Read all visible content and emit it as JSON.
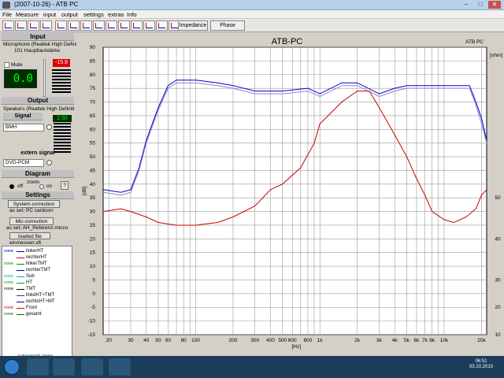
{
  "window": {
    "title": "(2007-10-26)  -  ATB PC",
    "minimize": "–",
    "maximize": "□",
    "close": "✕"
  },
  "menu": [
    "File",
    "Measure",
    "input",
    "output",
    "settings",
    "extras",
    "Info"
  ],
  "toolbar": {
    "impedance": "Impedance",
    "phase": "Phase"
  },
  "left": {
    "input_title": "Input",
    "input_device": "Microphone (Realtek High Defini",
    "input_channel": "101 Hauptlautstärke",
    "mute": "Mute",
    "in_lcd": "0.0",
    "in_level": "-15.8",
    "output_title": "Output",
    "output_device": "Speakers (Realtek High Definiti",
    "signal_title": "Signal",
    "signal_value": "BMH",
    "out_level": "2.50",
    "ext_title": "extern signal",
    "ext_value": "DVD-PCM",
    "diagram_title": "Diagram",
    "zoom": "zoom",
    "off": "off",
    "on": "on",
    "help": "?",
    "settings_title": "Settings",
    "sys_btn": "System-correction",
    "sys_as": "as set: PC cardcorr",
    "mic_btn": "Mic-correction",
    "mic_as": "as set: AH_Referenz.micco",
    "loaded_btn": "loaded file",
    "loaded_file": "einmessen.xft"
  },
  "legend": [
    {
      "a": "none",
      "b": "linkerHT",
      "color": "#0000cc",
      "acolor": "#0000cc"
    },
    {
      "a": "",
      "b": "rechterHT",
      "color": "#cc0000",
      "acolor": "#000"
    },
    {
      "a": "none",
      "b": "linkerTMT",
      "color": "#008800",
      "acolor": "#008800"
    },
    {
      "a": "",
      "b": "rechterTMT",
      "color": "#000088",
      "acolor": "#000"
    },
    {
      "a": "none",
      "b": "Sub",
      "color": "#00aaaa",
      "acolor": "#00aaaa"
    },
    {
      "a": "none",
      "b": "HT",
      "color": "#00aa00",
      "acolor": "#00aa00"
    },
    {
      "a": "none",
      "b": "TMT",
      "color": "#000000",
      "acolor": "#000"
    },
    {
      "a": "",
      "b": "linkdHT+TMT",
      "color": "#444444",
      "acolor": "#000"
    },
    {
      "a": "",
      "b": "rechtsHT+MT",
      "color": "#000088",
      "acolor": "#000"
    },
    {
      "a": "none",
      "b": "Front",
      "color": "#cc0000",
      "acolor": "#cc0000"
    },
    {
      "a": "none",
      "b": "gesamt",
      "color": "#006600",
      "acolor": "#006600"
    }
  ],
  "status": "autoexport: none",
  "clock": {
    "time": "06:51",
    "date": "03.10.2010"
  },
  "chart_data": {
    "type": "line",
    "title": "ATB-PC",
    "corner_label": "ATB PC",
    "xlabel": "[Hz]",
    "ylabel": "[dB]",
    "right_unit": "[ohm]",
    "x_scale": "log",
    "xlim": [
      18,
      22000
    ],
    "ylim": [
      -15,
      90
    ],
    "x_ticks": [
      {
        "v": 20,
        "t": "20"
      },
      {
        "v": 30,
        "t": "30"
      },
      {
        "v": 40,
        "t": "40"
      },
      {
        "v": 50,
        "t": "50"
      },
      {
        "v": 60,
        "t": "60"
      },
      {
        "v": 80,
        "t": "80"
      },
      {
        "v": 100,
        "t": "100"
      },
      {
        "v": 200,
        "t": "200"
      },
      {
        "v": 300,
        "t": "300"
      },
      {
        "v": 400,
        "t": "400"
      },
      {
        "v": 500,
        "t": "500"
      },
      {
        "v": 600,
        "t": "600"
      },
      {
        "v": 800,
        "t": "800"
      },
      {
        "v": 1000,
        "t": "1k"
      },
      {
        "v": 2000,
        "t": "2k"
      },
      {
        "v": 3000,
        "t": "3k"
      },
      {
        "v": 4000,
        "t": "4k"
      },
      {
        "v": 5000,
        "t": "5k"
      },
      {
        "v": 6000,
        "t": "6k"
      },
      {
        "v": 7000,
        "t": "7k"
      },
      {
        "v": 8000,
        "t": "8k"
      },
      {
        "v": 10000,
        "t": "10k"
      },
      {
        "v": 20000,
        "t": "20k"
      }
    ],
    "y_ticks": [
      90,
      85,
      80,
      75,
      70,
      65,
      60,
      55,
      50,
      45,
      40,
      35,
      30,
      25,
      20,
      15,
      10,
      5,
      0,
      -5,
      -10,
      -15
    ],
    "right_ticks": [
      {
        "y": 35,
        "t": "50"
      },
      {
        "y": 20,
        "t": "40"
      },
      {
        "y": 5,
        "t": "30"
      },
      {
        "y": -5,
        "t": "20"
      },
      {
        "y": -15,
        "t": "10"
      }
    ],
    "series": [
      {
        "color": "#0000cc",
        "points": [
          [
            18,
            38
          ],
          [
            25,
            37
          ],
          [
            30,
            38
          ],
          [
            35,
            46
          ],
          [
            40,
            56
          ],
          [
            50,
            68
          ],
          [
            60,
            76
          ],
          [
            70,
            78
          ],
          [
            100,
            78
          ],
          [
            150,
            77
          ],
          [
            200,
            76
          ],
          [
            300,
            74
          ],
          [
            500,
            74
          ],
          [
            800,
            75
          ],
          [
            1000,
            73
          ],
          [
            1500,
            77
          ],
          [
            2000,
            77
          ],
          [
            3000,
            73
          ],
          [
            4000,
            75
          ],
          [
            5000,
            76
          ],
          [
            8000,
            76
          ],
          [
            12000,
            76
          ],
          [
            16000,
            76
          ],
          [
            18000,
            70
          ],
          [
            20000,
            64
          ],
          [
            22000,
            56
          ]
        ]
      },
      {
        "color": "#8888cc",
        "points": [
          [
            18,
            37
          ],
          [
            25,
            36
          ],
          [
            30,
            37
          ],
          [
            35,
            45
          ],
          [
            40,
            55
          ],
          [
            50,
            67
          ],
          [
            60,
            75
          ],
          [
            70,
            77
          ],
          [
            100,
            77
          ],
          [
            150,
            76
          ],
          [
            200,
            75
          ],
          [
            300,
            73
          ],
          [
            500,
            73
          ],
          [
            800,
            74
          ],
          [
            1000,
            72
          ],
          [
            1500,
            76
          ],
          [
            2000,
            76
          ],
          [
            3000,
            72
          ],
          [
            4000,
            74
          ],
          [
            5000,
            75
          ],
          [
            8000,
            75
          ],
          [
            12000,
            75
          ],
          [
            16000,
            75
          ],
          [
            18000,
            69
          ],
          [
            20000,
            62
          ],
          [
            22000,
            55
          ]
        ]
      },
      {
        "color": "#cc0000",
        "points": [
          [
            18,
            30
          ],
          [
            25,
            31
          ],
          [
            30,
            30
          ],
          [
            40,
            28
          ],
          [
            50,
            26
          ],
          [
            70,
            25
          ],
          [
            100,
            25
          ],
          [
            150,
            26
          ],
          [
            200,
            28
          ],
          [
            300,
            32
          ],
          [
            400,
            38
          ],
          [
            500,
            40
          ],
          [
            700,
            46
          ],
          [
            900,
            55
          ],
          [
            1000,
            62
          ],
          [
            1500,
            70
          ],
          [
            2000,
            74
          ],
          [
            2500,
            74
          ],
          [
            3000,
            68
          ],
          [
            4000,
            58
          ],
          [
            5000,
            50
          ],
          [
            6000,
            42
          ],
          [
            7000,
            36
          ],
          [
            8000,
            30
          ],
          [
            10000,
            27
          ],
          [
            12000,
            26
          ],
          [
            15000,
            28
          ],
          [
            18000,
            31
          ],
          [
            20000,
            36
          ],
          [
            22000,
            38
          ]
        ]
      }
    ]
  }
}
